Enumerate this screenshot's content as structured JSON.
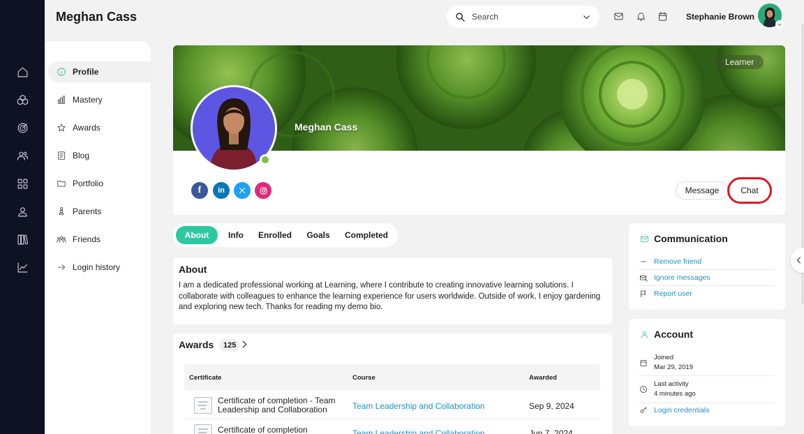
{
  "header": {
    "page_title": "Meghan Cass",
    "search_placeholder": "Search",
    "user_name": "Stephanie Brown",
    "icons": [
      "mail-icon",
      "bell-icon",
      "calendar-icon"
    ]
  },
  "rail": {
    "icons": [
      "home-icon",
      "cubes-icon",
      "target-icon",
      "users-icon",
      "grid-icon",
      "user-icon",
      "library-icon",
      "chart-line-icon"
    ]
  },
  "subnav": {
    "items": [
      {
        "label": "Profile",
        "icon": "info-icon",
        "active": true
      },
      {
        "label": "Mastery",
        "icon": "bar-chart-icon"
      },
      {
        "label": "Awards",
        "icon": "star-icon"
      },
      {
        "label": "Blog",
        "icon": "document-icon"
      },
      {
        "label": "Portfolio",
        "icon": "folder-icon"
      },
      {
        "label": "Parents",
        "icon": "chess-icon"
      },
      {
        "label": "Friends",
        "icon": "people-icon"
      },
      {
        "label": "Login history",
        "icon": "arrow-right-icon"
      }
    ]
  },
  "profile": {
    "name": "Meghan Cass",
    "role": "Learner",
    "social": [
      "facebook",
      "linkedin",
      "x",
      "instagram"
    ],
    "message_label": "Message",
    "chat_label": "Chat",
    "colors": {
      "facebook": "#3b5998",
      "linkedin": "#0a77b5",
      "x": "#1da1f2",
      "instagram": "#e4287b",
      "accent": "#2cc9a0",
      "highlight": "#e11522"
    }
  },
  "tabs": [
    {
      "label": "About",
      "active": true
    },
    {
      "label": "Info"
    },
    {
      "label": "Enrolled"
    },
    {
      "label": "Goals"
    },
    {
      "label": "Completed"
    }
  ],
  "about": {
    "title": "About",
    "body": "I am a dedicated professional working at Learning, where I contribute to creating innovative learning solutions. I collaborate with colleagues to enhance the learning experience for users worldwide. Outside of work, I enjoy gardening and exploring new tech. Thanks for reading my demo bio."
  },
  "awards": {
    "title": "Awards",
    "count": "125",
    "columns": [
      "Certificate",
      "Course",
      "Awarded"
    ],
    "rows": [
      {
        "certificate": "Certificate of completion - Team Leadership and Collaboration",
        "course": "Team Leadership and Collaboration",
        "awarded": "Sep 9, 2024"
      },
      {
        "certificate": "Certificate of completion",
        "course": "Team Leadership and Collaboration",
        "awarded": "Jun 7, 2024"
      }
    ]
  },
  "communication": {
    "title": "Communication",
    "items": [
      {
        "label": "Remove friend",
        "icon": "minus-icon"
      },
      {
        "label": "Ignore messages",
        "icon": "mail-off-icon"
      },
      {
        "label": "Report user",
        "icon": "flag-icon"
      }
    ]
  },
  "account": {
    "title": "Account",
    "joined_label": "Joined",
    "joined_value": "Mar 29, 2019",
    "last_activity_label": "Last activity",
    "last_activity_value": "4 minutes ago",
    "login_credentials": "Login credentials"
  }
}
